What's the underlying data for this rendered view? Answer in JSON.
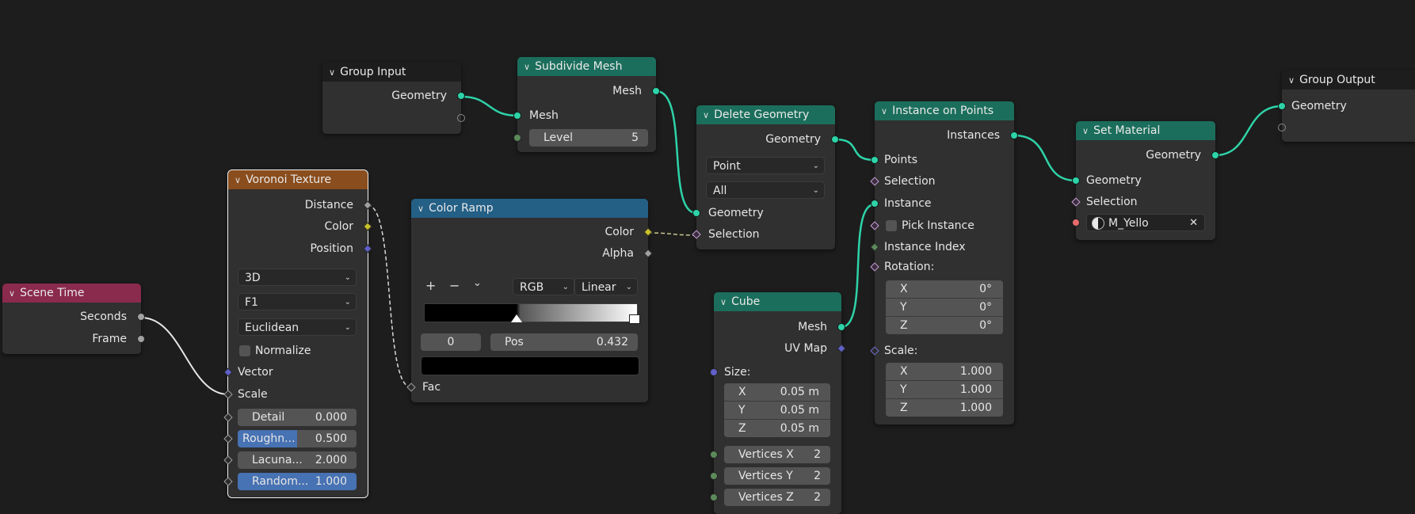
{
  "colors": {
    "background": "#1d1d1d",
    "node_body": "#303030",
    "geometry_header": "#1b6e5c",
    "texture_header": "#8a4d1d",
    "converter_header": "#245f86",
    "input_header": "#8a2a4c",
    "geometry_socket": "#2ed3a8"
  },
  "group_input": {
    "title": "Group Input",
    "outputs": [
      "Geometry"
    ]
  },
  "subdivide": {
    "title": "Subdivide Mesh",
    "out_mesh": "Mesh",
    "in_mesh": "Mesh",
    "level_label": "Level",
    "level_value": "5"
  },
  "delete_geo": {
    "title": "Delete Geometry",
    "out_geometry": "Geometry",
    "domain": "Point",
    "mode": "All",
    "in_geometry": "Geometry",
    "in_selection": "Selection"
  },
  "instance": {
    "title": "Instance on Points",
    "out_instances": "Instances",
    "points": "Points",
    "selection": "Selection",
    "instance": "Instance",
    "pick_instance": "Pick Instance",
    "instance_index": "Instance Index",
    "rotation": "Rotation:",
    "rot": [
      {
        "axis": "X",
        "value": "0°"
      },
      {
        "axis": "Y",
        "value": "0°"
      },
      {
        "axis": "Z",
        "value": "0°"
      }
    ],
    "scale": "Scale:",
    "scl": [
      {
        "axis": "X",
        "value": "1.000"
      },
      {
        "axis": "Y",
        "value": "1.000"
      },
      {
        "axis": "Z",
        "value": "1.000"
      }
    ]
  },
  "set_material": {
    "title": "Set Material",
    "out_geometry": "Geometry",
    "in_geometry": "Geometry",
    "selection": "Selection",
    "material": "M_Yello"
  },
  "group_output": {
    "title": "Group Output",
    "geometry": "Geometry"
  },
  "voronoi": {
    "title": "Voronoi Texture",
    "out_distance": "Distance",
    "out_color": "Color",
    "out_position": "Position",
    "dimensions": "3D",
    "feature": "F1",
    "metric": "Euclidean",
    "normalize": "Normalize",
    "vector": "Vector",
    "scale": "Scale",
    "detail_label": "Detail",
    "detail_value": "0.000",
    "roughness_label": "Roughn...",
    "roughness_value": "0.500",
    "roughness_fill": 0.5,
    "lacunarity_label": "Lacuna...",
    "lacunarity_value": "2.000",
    "randomness_label": "Random...",
    "randomness_value": "1.000",
    "randomness_fill": 1.0
  },
  "color_ramp": {
    "title": "Color Ramp",
    "out_color": "Color",
    "out_alpha": "Alpha",
    "color_mode": "RGB",
    "interpolation": "Linear",
    "stop_index": "0",
    "pos_label": "Pos",
    "pos_value": "0.432",
    "fac": "Fac",
    "add_icon": "plus-icon",
    "remove_icon": "minus-icon"
  },
  "scene_time": {
    "title": "Scene Time",
    "seconds": "Seconds",
    "frame": "Frame"
  },
  "cube": {
    "title": "Cube",
    "out_mesh": "Mesh",
    "out_uvmap": "UV Map",
    "size": "Size:",
    "sz": [
      {
        "axis": "X",
        "value": "0.05 m"
      },
      {
        "axis": "Y",
        "value": "0.05 m"
      },
      {
        "axis": "Z",
        "value": "0.05 m"
      }
    ],
    "vx_label": "Vertices X",
    "vx_value": "2",
    "vy_label": "Vertices Y",
    "vy_value": "2",
    "vz_label": "Vertices Z",
    "vz_value": "2"
  }
}
